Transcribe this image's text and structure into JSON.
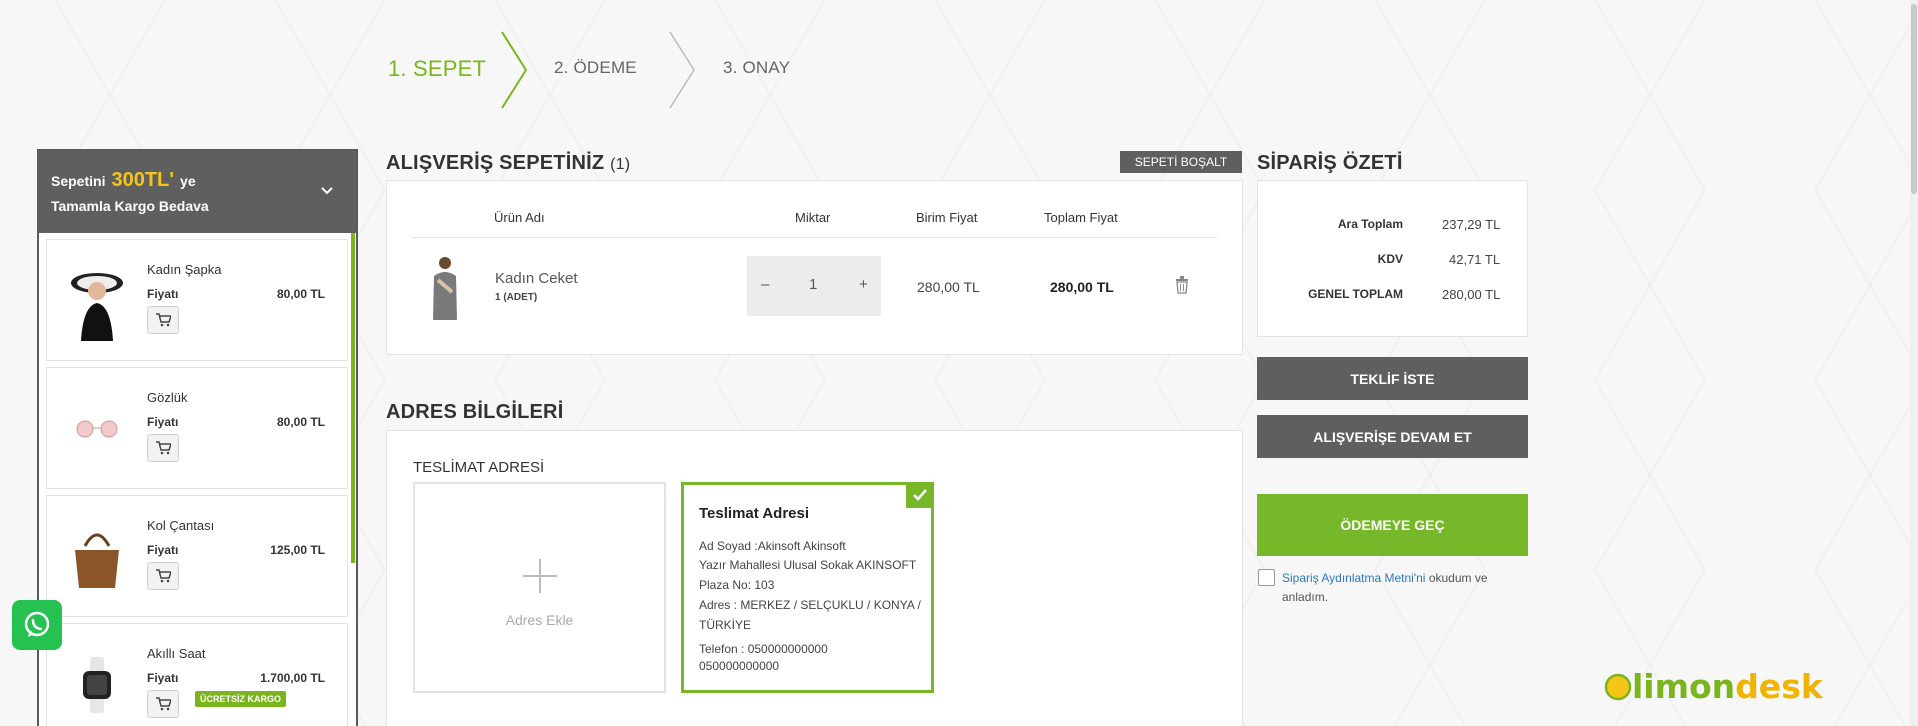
{
  "steps": [
    {
      "label": "1. SEPET"
    },
    {
      "label": "2. ÖDEME"
    },
    {
      "label": "3. ONAY"
    }
  ],
  "promo": {
    "prefix": "Sepetini",
    "amount": "300TL'",
    "suffix": "ye",
    "line2": "Tamamla Kargo Bedava"
  },
  "suggested_products": [
    {
      "name": "Kadın Şapka",
      "price_label": "Fiyatı",
      "price": "80,00 TL",
      "icon": "hat-model-image"
    },
    {
      "name": "Gözlük",
      "price_label": "Fiyatı",
      "price": "80,00 TL",
      "icon": "glasses-image"
    },
    {
      "name": "Kol Çantası",
      "price_label": "Fiyatı",
      "price": "125,00 TL",
      "icon": "handbag-image"
    },
    {
      "name": "Akıllı Saat",
      "price_label": "Fiyatı",
      "price": "1.700,00 TL",
      "icon": "smartwatch-image",
      "badge": "ÜCRETSİZ KARGO"
    }
  ],
  "cart": {
    "title": "ALIŞVERİŞ SEPETİNİZ",
    "count": "(1)",
    "empty_button": "SEPETİ BOŞALT",
    "headers": {
      "name": "Ürün Adı",
      "qty": "Miktar",
      "unit": "Birim Fiyat",
      "total": "Toplam Fiyat"
    },
    "items": [
      {
        "name": "Kadın Ceket",
        "sub": "1 (ADET)",
        "qty": "1",
        "unit_price": "280,00 TL",
        "total_price": "280,00 TL"
      }
    ],
    "minus": "–",
    "plus": "+"
  },
  "summary": {
    "title": "SİPARİŞ ÖZETİ",
    "rows": [
      {
        "label": "Ara Toplam",
        "value": "237,29 TL"
      },
      {
        "label": "KDV",
        "value": "42,71 TL"
      },
      {
        "label": "GENEL TOPLAM",
        "value": "280,00 TL"
      }
    ],
    "quote_button": "TEKLİF İSTE",
    "continue_button": "ALIŞVERİŞE DEVAM ET",
    "checkout_button": "ÖDEMEYE GEÇ",
    "consent_link": "Sipariş Aydınlatma Metni'ni",
    "consent_text1": "okudum ve",
    "consent_text2": "anladım."
  },
  "address": {
    "title": "ADRES BİLGİLERİ",
    "subtitle": "TESLİMAT ADRESİ",
    "add_label": "Adres Ekle",
    "card": {
      "title": "Teslimat Adresi",
      "name": "Ad Soyad :Akinsoft Akinsoft",
      "street": "Yazır Mahallesi Ulusal Sokak AKINSOFT",
      "plaza": "Plaza No: 103",
      "region1": "Adres : MERKEZ / SELÇUKLU / KONYA /",
      "region2": "TÜRKİYE",
      "phone": "Telefon : 050000000000",
      "phone2": "050000000000"
    }
  },
  "logo": {
    "part1": "limon",
    "part2": "desk"
  },
  "colors": {
    "accent": "#7ab51d",
    "dark": "#5f5f5f",
    "highlight": "#f5c518",
    "whatsapp": "#25c252"
  }
}
